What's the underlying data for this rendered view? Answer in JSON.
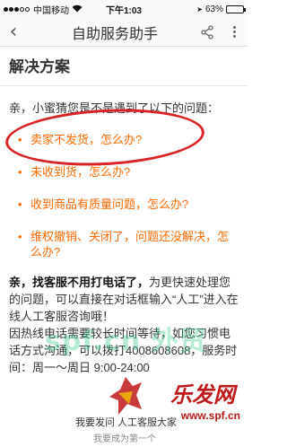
{
  "status_bar": {
    "carrier": "中国移动",
    "wifi": "WiFi",
    "time": "下午1:03",
    "location_glyph": "➤",
    "battery_text": "63%",
    "battery_level": 0.63
  },
  "nav": {
    "back_glyph": "‹",
    "title": "自助服务助手"
  },
  "section": {
    "title": "解决方案"
  },
  "intro": "亲，小蜜猜您是不是遇到了以下的问题：",
  "questions": [
    {
      "bullet": "•",
      "text": "卖家不发货，怎么办?"
    },
    {
      "bullet": "•",
      "text": "未收到货，怎么办?"
    },
    {
      "bullet": "•",
      "text": "收到商品有质量问题，怎么办?"
    },
    {
      "bullet": "•",
      "text": "维权撤销、关闭了，问题还没解决，怎么办?"
    }
  ],
  "note": {
    "bold": "亲，找客服不用打电话了，",
    "text1": "为更快速处理您的问题，可以直接在对话框输入“人工”进入在线人工客服咨询哦！",
    "text2": "因热线电话需要较长时间等待，如您习惯电话方式沟通，可以拨打4008608608，服务时间：周一～周日 9:00-24:00"
  },
  "bottom": {
    "line1": "我要发问    人工客服大家",
    "line2": "我要成为第一个"
  },
  "watermarks": {
    "center": "spf.cn  外贸",
    "brand": "乐发网",
    "site": "www.spf.cn"
  },
  "colors": {
    "accent": "#ff6a00",
    "highlight": "#d92222",
    "watermark_brand": "#c01818"
  }
}
